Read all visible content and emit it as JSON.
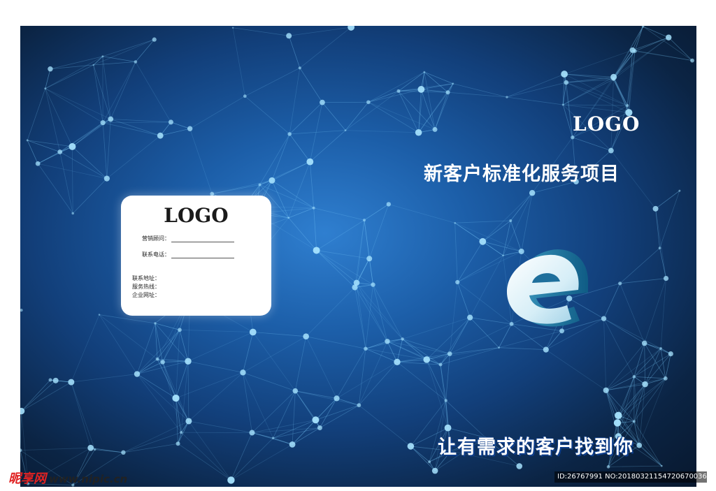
{
  "cover": {
    "logo_top": "LOGO",
    "title": "新客户标准化服务项目",
    "slogan": "让有需求的客户找到你",
    "accent_color": "#1c5ea8",
    "emblem_icon": "letter-e-3d-icon"
  },
  "card": {
    "logo": "LOGO",
    "fields": [
      {
        "label": "营销顾问："
      },
      {
        "label": "联系电话："
      }
    ],
    "contacts": [
      {
        "label": "联系地址："
      },
      {
        "label": "服务热线："
      },
      {
        "label": "企业网址："
      }
    ]
  },
  "watermark": {
    "brand": "昵享网",
    "site": "www.nipic.cn",
    "id_text": "ID:26767991 NO:20180321154720670036"
  }
}
